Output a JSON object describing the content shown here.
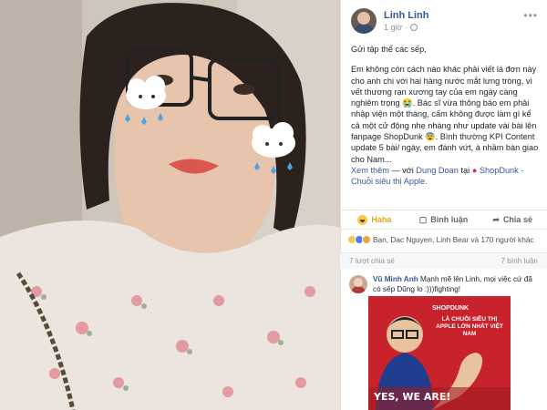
{
  "post": {
    "author": "Linh Linh",
    "time": "1 giờ",
    "greeting": "Gửi tập thể các sếp,",
    "body_text": "Em không còn cách nào khác phải viết lá đơn này cho anh chị với hai hàng nước mắt lưng tròng, vì vết thương rạn xương tay của em ngày càng nghiêm trọng 😭. Bác sĩ vừa thông báo em phải nhập viện một tháng, cấm không được làm gì kể cả một cử động nhẹ nhàng như update vài bài lên fanpage ShopDunk 😨. Bình thường KPI Content update 5 bài/ ngày, em đánh vứt, à nhầm bàn giao cho Nam...",
    "see_more": "Xem thêm",
    "with_label": "— với",
    "tagged": "Dung Doan",
    "at_label": "tại",
    "location": "ShopDunk - Chuỗi siêu thị Apple."
  },
  "actions": {
    "reaction_label": "Haha",
    "comment_label": "Bình luận",
    "share_label": "Chia sẻ"
  },
  "reactions": {
    "summary": "Bạn, Dac Nguyen, Linh Bear và 170 người khác"
  },
  "stats": {
    "shares": "7 lượt chia sẻ",
    "comments": "7 bình luận"
  },
  "comment": {
    "name": "Vũ Minh Anh",
    "text": "Mạnh mẽ lên Linh, mọi việc cứ đã có sếp Dũng lo :)))fighting!"
  },
  "poster": {
    "brand": "SHOPDUNK",
    "tagline": "LÀ CHUỖI SIÊU THỊ APPLE LỚN NHẤT VIỆT NAM",
    "slogan": "YES, WE ARE!"
  },
  "colors": {
    "link": "#365899",
    "haha": "#e7a31b",
    "poster_red": "#c8232c"
  }
}
